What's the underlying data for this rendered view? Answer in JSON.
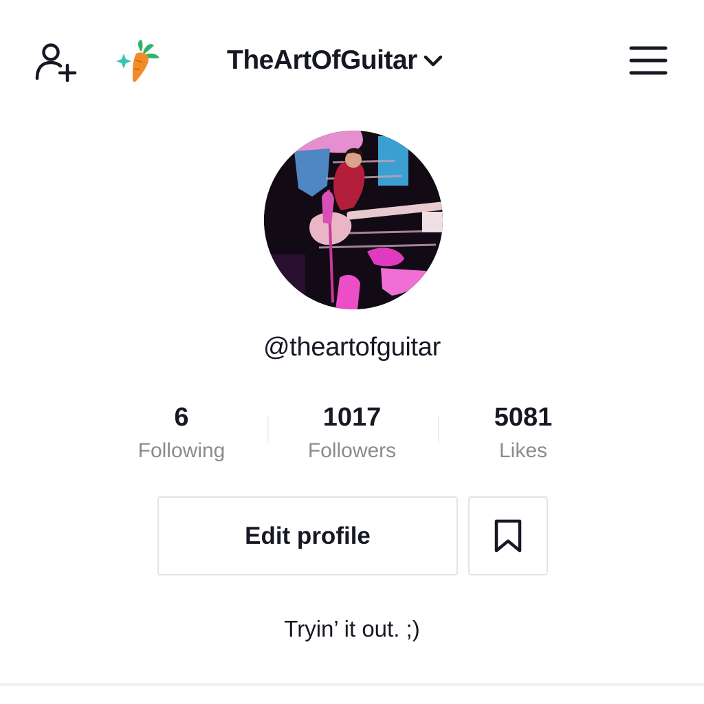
{
  "header": {
    "account_name": "TheArtOfGuitar",
    "add_user_icon": "add-user-icon",
    "promo_icon": "carrot-icon",
    "switch_icon": "chevron-down-icon",
    "menu_icon": "hamburger-menu-icon"
  },
  "profile": {
    "avatar": "avatar",
    "username": "@theartofguitar",
    "bio": "Tryin’ it out. ;)"
  },
  "stats": [
    {
      "value": "6",
      "label": "Following"
    },
    {
      "value": "1017",
      "label": "Followers"
    },
    {
      "value": "5081",
      "label": "Likes"
    }
  ],
  "actions": {
    "edit_profile_label": "Edit profile",
    "bookmark_icon": "bookmark-icon"
  },
  "colors": {
    "text_primary": "#161823",
    "text_secondary": "#8a8b91",
    "border": "#e3e3e4",
    "carrot_orange": "#f28c28",
    "carrot_leaf": "#2fb36a"
  }
}
